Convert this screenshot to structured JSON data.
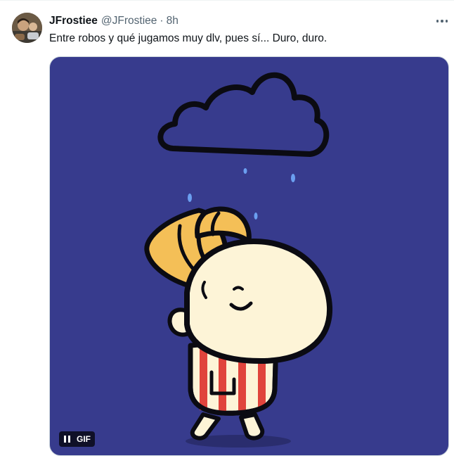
{
  "tweet": {
    "display_name": "JFrostiee",
    "handle": "@JFrostiee",
    "separator": "·",
    "time": "8h",
    "text": "Entre robos y qué jugamos muy dlv, pues sí... Duro, duro."
  },
  "media": {
    "badge": "GIF",
    "pause_icon": "pause-icon",
    "background_color": "#373b8d"
  },
  "icons": {
    "more": "more-options-icon"
  }
}
